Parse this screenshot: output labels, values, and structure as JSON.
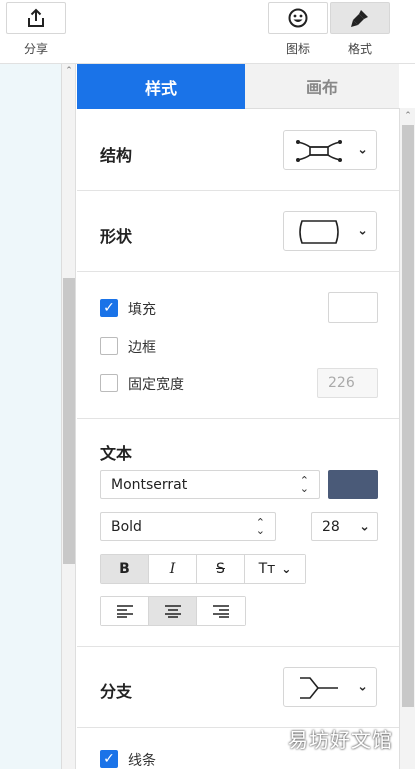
{
  "toolbar": {
    "share_label": "分享",
    "icon_label": "图标",
    "format_label": "格式"
  },
  "tabs": {
    "style": "样式",
    "canvas": "画布"
  },
  "structure": {
    "title": "结构"
  },
  "shape": {
    "title": "形状"
  },
  "options": {
    "fill_label": "填充",
    "fill_checked": true,
    "border_label": "边框",
    "border_checked": false,
    "fixed_width_label": "固定宽度",
    "fixed_width_checked": false,
    "fixed_width_value": "226"
  },
  "text": {
    "title": "文本",
    "font_family": "Montserrat",
    "font_color": "#4a5a78",
    "font_weight": "Bold",
    "font_size": "28",
    "bold_glyph": "B",
    "italic_glyph": "I",
    "strike_glyph": "S",
    "case_glyph": "Tт"
  },
  "branch": {
    "title": "分支"
  },
  "lines": {
    "label": "线条",
    "checked": true
  },
  "watermark": "易坊好文馆",
  "colors": {
    "accent": "#1a73e8",
    "left_bg": "#eef7fa"
  }
}
